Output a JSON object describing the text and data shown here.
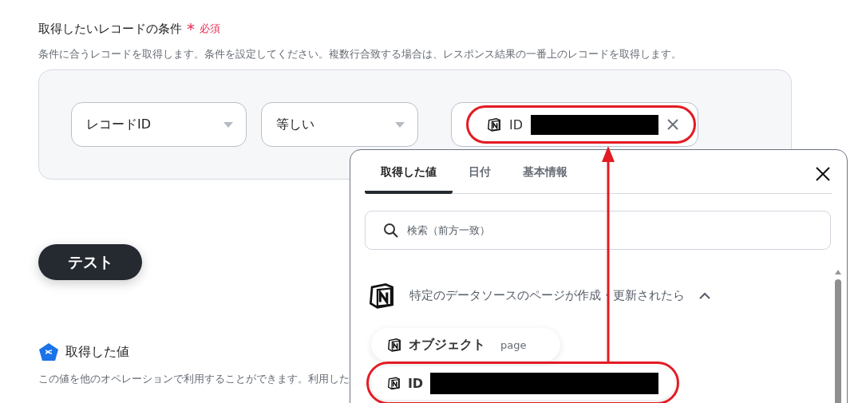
{
  "section": {
    "title": "取得したいレコードの条件",
    "required_mark": "*",
    "required_label": "必須",
    "description": "条件に合うレコードを取得します。条件を設定してください。複数行合致する場合は、レスポンス結果の一番上のレコードを取得します。"
  },
  "condition": {
    "field": "レコードID",
    "operator": "等しい",
    "value_chip": {
      "label": "ID",
      "redacted": true,
      "highlighted": true
    }
  },
  "test_button": "テスト",
  "output": {
    "title": "取得した値",
    "description": "この値を他のオペレーションで利用することができます。利用した"
  },
  "popup": {
    "tabs": [
      {
        "label": "取得した値",
        "selected": true
      },
      {
        "label": "日付",
        "selected": false
      },
      {
        "label": "基本情報",
        "selected": false
      }
    ],
    "search": {
      "placeholder": "検索（前方一致）"
    },
    "group": {
      "title": "特定のデータソースのページが作成・更新されたら",
      "expanded": true,
      "items": [
        {
          "label": "オブジェクト",
          "value": "page"
        },
        {
          "label": "ID",
          "redacted": true,
          "highlighted": true
        }
      ]
    }
  }
}
